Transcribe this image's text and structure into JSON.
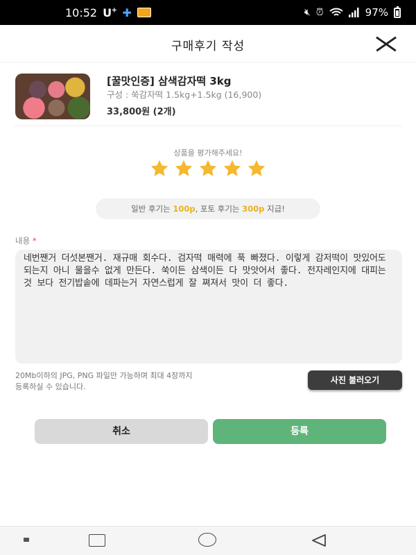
{
  "status_bar": {
    "time": "10:52",
    "carrier": "U",
    "carrier_sup": "+",
    "battery_percent": "97%",
    "icons": [
      "mute-icon",
      "alarm-icon",
      "wifi-icon",
      "signal-icon",
      "battery-icon"
    ]
  },
  "header": {
    "title": "구매후기 작성",
    "close_icon": "close-icon"
  },
  "product": {
    "name": "[꿀맛인증] 삼색감자떡 3kg",
    "option": "구성 : 쑥감자떡 1.5kg+1.5kg (16,900)",
    "price": "33,800원 (2개)"
  },
  "rating": {
    "prompt": "상품을 평가해주세요!",
    "stars": 5,
    "max_stars": 5,
    "star_color": "#f5b82e"
  },
  "points": {
    "text_1": "일반 후기는 ",
    "value_1": "100p",
    "text_2": ", 포토 후기는 ",
    "value_2": "300p",
    "text_3": " 지급!"
  },
  "review": {
    "label": "내용",
    "required_mark": "*",
    "content": "네번짼거 더섯본짼거. 재규매 회수다. 검자떡 매력에 푹 빠졌다. 이렇게 감저떡이 맛있어도 되는지 아니 물을수 없게 만든다. 쑥이든 삼색이든 다 맛앗어서 좋다. 전자레인지에 대피는것 보다 전기밥솥에 데파는거 자연스럽게 잘 쪄져서 맛이 더 좋다."
  },
  "upload": {
    "note_line1": "20Mb이하의 JPG, PNG 파일만 가능하며 최대 4장까지",
    "note_line2": "등록하실 수 있습니다.",
    "button_label": "사진 불러오기"
  },
  "actions": {
    "cancel_label": "취소",
    "submit_label": "등록"
  },
  "colors": {
    "submit": "#5fb47a",
    "highlight": "#e8b21a",
    "required": "#e14a4a"
  }
}
